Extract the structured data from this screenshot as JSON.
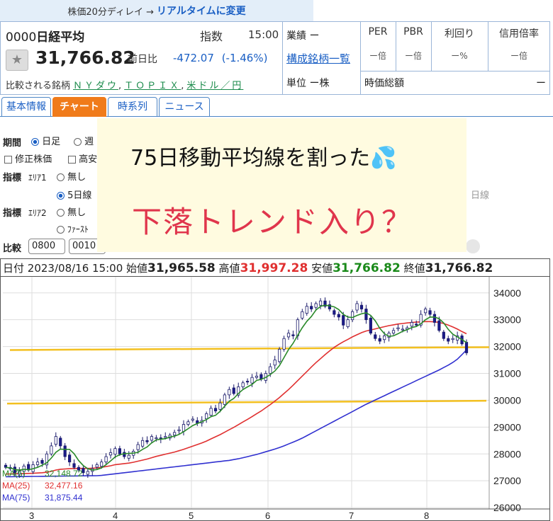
{
  "delay_banner": {
    "text": "株価20分ディレイ →",
    "link": "リアルタイムに変更"
  },
  "quote": {
    "code": "0000",
    "name": "日経平均",
    "kind": "指数",
    "time": "15:00",
    "price": "31,766.82",
    "prev_label": "前日比",
    "change": "-472.07",
    "change_pct": "(-1.46%)",
    "compare_label": "比較される銘柄",
    "compare_links": [
      "ＮＹダウ",
      "ＴＯＰＩＸ",
      "米ドル／円"
    ]
  },
  "side": {
    "gyoseki": "業績 ー",
    "kosei_link": "構成銘柄一覧",
    "tani": "単位 ー株",
    "metrics": [
      {
        "label": "PER",
        "value": "ー倍"
      },
      {
        "label": "PBR",
        "value": "ー倍"
      },
      {
        "label": "利回り",
        "value": "ー%"
      },
      {
        "label": "信用倍率",
        "value": "ー倍"
      }
    ],
    "soukaku_label": "時価総額",
    "soukaku_value": "ー"
  },
  "tabs": [
    {
      "label": "基本情報",
      "active": false
    },
    {
      "label": "チャート",
      "active": true
    },
    {
      "label": "時系列",
      "active": false
    },
    {
      "label": "ニュース",
      "active": false
    }
  ],
  "controls": {
    "period_label": "期間",
    "period_daily": "日足",
    "period_weekly": "週",
    "adj_label": "修正株価",
    "high_label": "高安",
    "ind1_label": "指標",
    "area1": "ｴﾘｱ1",
    "none1": "無し",
    "ma5": "5日線",
    "ind2_label": "指標",
    "area2": "ｴﾘｱ2",
    "none2": "無し",
    "first": "ﾌｧｰｽﾄ",
    "compare_label": "比較",
    "compare_1": "0800",
    "compare_2": "0010",
    "right_hint": "日線"
  },
  "overlay": {
    "line1": "75日移動平均線を割った💦",
    "line2": "下落トレンド入り？"
  },
  "ohlc": {
    "date_label": "日付",
    "date": "2023/08/16 15:00",
    "open_label": "始値",
    "open": "31,965.58",
    "high_label": "高値",
    "high": "31,997.28",
    "low_label": "安値",
    "low": "31,766.82",
    "close_label": "終値",
    "close": "31,766.82"
  },
  "chart_data": {
    "type": "line",
    "yticks": [
      26000,
      27000,
      28000,
      29000,
      30000,
      31000,
      32000,
      33000,
      34000
    ],
    "ylim": [
      25950,
      34600
    ],
    "xticks": [
      "3",
      "4",
      "5",
      "6",
      "7",
      "8"
    ],
    "legend": [
      {
        "name": "MA(5)",
        "value": "32,148.72",
        "color": "#2a8a2a"
      },
      {
        "name": "MA(25)",
        "value": "32,477.16",
        "color": "#e03030"
      },
      {
        "name": "MA(75)",
        "value": "31,875.44",
        "color": "#3030d0"
      }
    ],
    "close": [
      27500,
      27450,
      27300,
      27350,
      27550,
      27400,
      27600,
      27700,
      27650,
      28000,
      28300,
      28650,
      28300,
      27900,
      27700,
      27500,
      27400,
      27300,
      27350,
      27450,
      27600,
      27700,
      27900,
      28050,
      28200,
      28000,
      27900,
      27950,
      28100,
      28350,
      28500,
      28450,
      28650,
      28600,
      28550,
      28650,
      28700,
      28800,
      28900,
      29100,
      29200,
      29300,
      29150,
      29250,
      29500,
      29700,
      29600,
      29900,
      30200,
      30400,
      30250,
      30500,
      30650,
      30700,
      30850,
      30900,
      30800,
      31000,
      31250,
      31500,
      31900,
      32300,
      32500,
      32400,
      33000,
      33300,
      33500,
      33400,
      33600,
      33700,
      33500,
      33400,
      33200,
      33100,
      32800,
      33000,
      33300,
      33600,
      33400,
      33000,
      32500,
      32300,
      32200,
      32400,
      32500,
      32600,
      32700,
      32650,
      32700,
      32900,
      32800,
      33200,
      33400,
      33200,
      32900,
      32600,
      32300,
      32200,
      32300,
      32400,
      32100,
      31766
    ],
    "ma5": [
      27500,
      27480,
      27420,
      27400,
      27430,
      27410,
      27450,
      27500,
      27580,
      27670,
      27850,
      28060,
      28180,
      28170,
      28170,
      28010,
      27750,
      27570,
      27450,
      27400,
      27420,
      27480,
      27600,
      27740,
      27890,
      27970,
      28010,
      28020,
      28030,
      28060,
      28170,
      28260,
      28410,
      28520,
      28550,
      28570,
      28630,
      28660,
      28730,
      28830,
      28940,
      29060,
      29130,
      29200,
      29280,
      29390,
      29440,
      29590,
      29780,
      29960,
      30070,
      30250,
      30400,
      30500,
      30590,
      30740,
      30780,
      30850,
      30960,
      31090,
      31290,
      31590,
      31890,
      32120,
      32420,
      32700,
      32940,
      33120,
      33360,
      33500,
      33540,
      33520,
      33480,
      33380,
      33200,
      33100,
      33080,
      33160,
      33220,
      33260,
      33160,
      32960,
      32680,
      32480,
      32380,
      32400,
      32480,
      32570,
      32630,
      32710,
      32750,
      32850,
      33000,
      33100,
      33100,
      33040,
      32880,
      32640,
      32460,
      32360,
      32260,
      32150
    ],
    "ma25": [
      27250,
      27255,
      27260,
      27265,
      27270,
      27275,
      27280,
      27290,
      27300,
      27320,
      27350,
      27400,
      27430,
      27440,
      27450,
      27455,
      27460,
      27460,
      27460,
      27470,
      27480,
      27500,
      27530,
      27560,
      27600,
      27620,
      27640,
      27660,
      27690,
      27730,
      27770,
      27810,
      27860,
      27910,
      27950,
      27990,
      28030,
      28070,
      28120,
      28170,
      28230,
      28290,
      28350,
      28410,
      28480,
      28560,
      28640,
      28720,
      28810,
      28900,
      28990,
      29090,
      29190,
      29290,
      29390,
      29500,
      29600,
      29720,
      29840,
      29970,
      30100,
      30250,
      30400,
      30560,
      30730,
      30900,
      31070,
      31240,
      31400,
      31550,
      31700,
      31840,
      31970,
      32080,
      32180,
      32270,
      32360,
      32440,
      32520,
      32580,
      32620,
      32660,
      32700,
      32740,
      32780,
      32810,
      32840,
      32860,
      32880,
      32900,
      32910,
      32920,
      32930,
      32930,
      32920,
      32900,
      32860,
      32800,
      32730,
      32650,
      32560,
      32477
    ],
    "ma75": [
      27150,
      27152,
      27154,
      27156,
      27158,
      27160,
      27162,
      27164,
      27166,
      27168,
      27170,
      27172,
      27174,
      27176,
      27178,
      27180,
      27182,
      27184,
      27186,
      27188,
      27190,
      27200,
      27220,
      27240,
      27260,
      27280,
      27300,
      27320,
      27340,
      27360,
      27380,
      27400,
      27420,
      27440,
      27460,
      27480,
      27500,
      27520,
      27540,
      27560,
      27580,
      27600,
      27620,
      27640,
      27660,
      27680,
      27700,
      27720,
      27740,
      27760,
      27790,
      27820,
      27860,
      27900,
      27940,
      27980,
      28030,
      28080,
      28130,
      28180,
      28240,
      28300,
      28370,
      28440,
      28510,
      28590,
      28680,
      28770,
      28860,
      28950,
      29040,
      29130,
      29220,
      29310,
      29400,
      29490,
      29580,
      29670,
      29760,
      29850,
      29930,
      30010,
      30090,
      30170,
      30250,
      30330,
      30410,
      30490,
      30570,
      30650,
      30730,
      30810,
      30890,
      30970,
      31050,
      31130,
      31220,
      31310,
      31410,
      31530,
      31700,
      31875
    ],
    "hlines": [
      31950,
      29980
    ]
  }
}
